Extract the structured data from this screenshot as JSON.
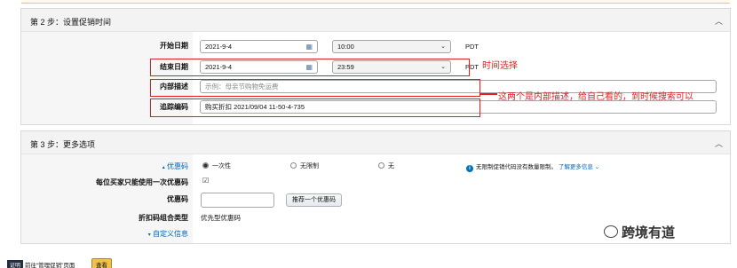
{
  "step2": {
    "title": "第 2 步：设置促销时间",
    "start_label": "开始日期",
    "start_date": "2021-9-4",
    "start_time": "10:00",
    "start_tz": "PDT",
    "end_label": "结束日期",
    "end_date": "2021-9-4",
    "end_time": "23:59",
    "end_tz": "PDT",
    "internal_label": "内部描述",
    "internal_placeholder": "示例：母亲节购物免运费",
    "tracking_label": "追踪编码",
    "tracking_value": "购买折扣 2021/09/04 11-50-4-735"
  },
  "annotations": {
    "time_note": "时间选择",
    "desc_note": "这两个是内部描述，给自己看的，到时候搜索可以"
  },
  "step3": {
    "title": "第 3 步：更多选项",
    "coupon_label": "优惠码",
    "coupon_options": [
      "一次性",
      "无限制",
      "无"
    ],
    "coupon_info": "无限制促销代码没有数量限制。",
    "learn_more": "了解更多信息",
    "once_label": "每位买家只能使用一次优惠码",
    "code_label": "优惠码",
    "suggest_button": "推荐一个优惠码",
    "combo_label": "折扣码组合类型",
    "combo_value": "优先型优惠码",
    "custom_label": "自定义信息"
  },
  "watermark": "跨境有道",
  "footer": {
    "tag": "证明",
    "goto_text": "前往“管理促销”页面",
    "view_button": "查看"
  }
}
